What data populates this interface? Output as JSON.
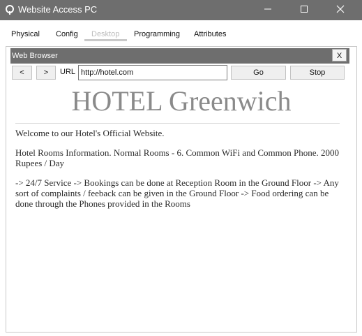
{
  "window": {
    "title": "Website Access PC",
    "icon": "packet-tracer-pc-icon"
  },
  "tabs": [
    {
      "label": "Physical",
      "active": false
    },
    {
      "label": "Config",
      "active": false
    },
    {
      "label": "Desktop",
      "active": true
    },
    {
      "label": "Programming",
      "active": false
    },
    {
      "label": "Attributes",
      "active": false
    }
  ],
  "browser": {
    "title": "Web Browser",
    "close_label": "X",
    "back_label": "<",
    "forward_label": ">",
    "url_label": "URL",
    "url_value": "http://hotel.com",
    "go_label": "Go",
    "stop_label": "Stop"
  },
  "page": {
    "heading": "HOTEL Greenwich",
    "paragraphs": [
      "Welcome to our Hotel's Official Website.",
      "Hotel Rooms Information. Normal Rooms - 6. Common WiFi and Common Phone. 2000 Rupees / Day",
      "-> 24/7 Service -> Bookings can be done at Reception Room in the Ground Floor -> Any sort of complaints / feeback can be given in the Ground Floor -> Food ordering can be done through the Phones provided in the Rooms"
    ]
  },
  "colors": {
    "titlebar": "#6e6e6e",
    "heading": "#8a8a8a"
  }
}
